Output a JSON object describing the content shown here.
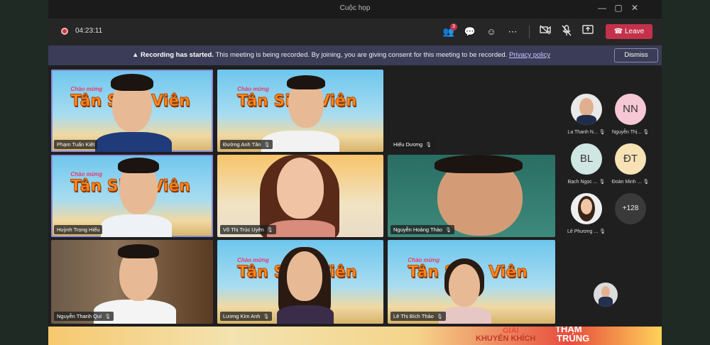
{
  "window": {
    "title": "Cuộc họp"
  },
  "toolbar": {
    "timer": "04:23:11",
    "participants_badge": "3",
    "leave_label": "Leave"
  },
  "banner": {
    "title": "Recording has started.",
    "message": "This meeting is being recorded. By joining, you are giving consent for this meeting to be recorded.",
    "link": "Privacy policy",
    "dismiss_label": "Dismiss"
  },
  "tiles": [
    {
      "name": "Phạm Tuấn Kiệt"
    },
    {
      "name": "Đường Anh Tân"
    },
    {
      "name": "Hiếu Dương"
    },
    {
      "name": "Huỳnh Trọng Hiếu"
    },
    {
      "name": "Võ Thị Trúc Uyên"
    },
    {
      "name": "Nguyễn Hoàng Thảo"
    },
    {
      "name": "Nguyễn Thanh Quí"
    },
    {
      "name": "Lương Kim Anh"
    },
    {
      "name": "Lê Thị Bích Thảo"
    }
  ],
  "banner_art": {
    "small": "Chào mừng",
    "word": "Tân Sinh Viên"
  },
  "side_participants": [
    {
      "name": "La Thanh N...",
      "initials": ""
    },
    {
      "name": "Nguyễn Thị...",
      "initials": "NN"
    },
    {
      "name": "Bạch Ngọc ...",
      "initials": "BL"
    },
    {
      "name": "Đoàn Minh ...",
      "initials": "ĐT"
    },
    {
      "name": "Lê Phương ...",
      "initials": ""
    },
    {
      "name": "",
      "initials": "+128"
    }
  ],
  "bottom_strip": {
    "text1": "GIẢI",
    "text2": "KHUYẾN KHÍCH",
    "text3": "THAM",
    "text4": "TRÚNG"
  },
  "colors": {
    "leave": "#c4314b",
    "banner": "#3b3c57",
    "speaking_outline": "#8b8cd6"
  }
}
